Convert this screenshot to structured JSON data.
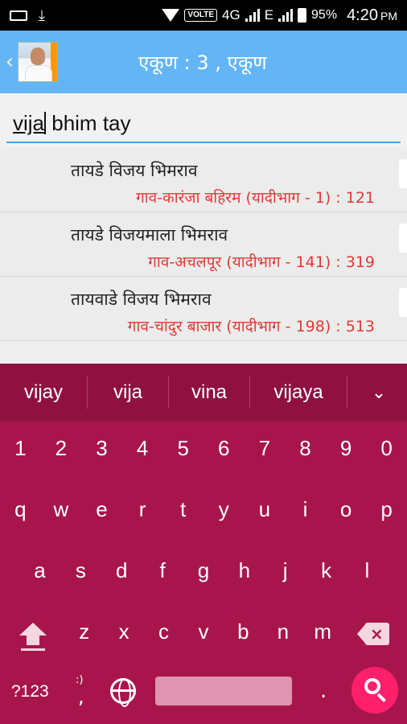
{
  "status_bar": {
    "network_label": "VOLTE",
    "network_type": "4G",
    "e_label": "E",
    "battery": "95%",
    "time": "4:20",
    "time_suffix": "PM"
  },
  "app_bar": {
    "title": "एकूण : 3 , एकूण"
  },
  "search": {
    "word_before_cursor": "vija",
    "text_after_cursor": " bhim tay"
  },
  "results": [
    {
      "name": "तायडे विजय भिमराव",
      "detail": "गाव-कारंजा बहिरम (यादीभाग - 1) : 121"
    },
    {
      "name": "तायडे विजयमाला भिमराव",
      "detail": "गाव-अचलपूर (यादीभाग - 141) : 319"
    },
    {
      "name": "तायवाडे विजय भिमराव",
      "detail": "गाव-चांदुर बाजार (यादीभाग - 198) : 513"
    }
  ],
  "keyboard": {
    "suggestions": [
      "vijay",
      "vija",
      "vina",
      "vijaya"
    ],
    "number_row": [
      "1",
      "2",
      "3",
      "4",
      "5",
      "6",
      "7",
      "8",
      "9",
      "0"
    ],
    "row1": [
      "q",
      "w",
      "e",
      "r",
      "t",
      "y",
      "u",
      "i",
      "o",
      "p"
    ],
    "row2": [
      "a",
      "s",
      "d",
      "f",
      "g",
      "h",
      "j",
      "k",
      "l"
    ],
    "row3": [
      "z",
      "x",
      "c",
      "v",
      "b",
      "n",
      "m"
    ],
    "symbols_label": "?123",
    "emoji_hint": ":)",
    "comma": ",",
    "period": ".",
    "accent_color": "#ff1f6b",
    "background_color": "#a8154d"
  }
}
